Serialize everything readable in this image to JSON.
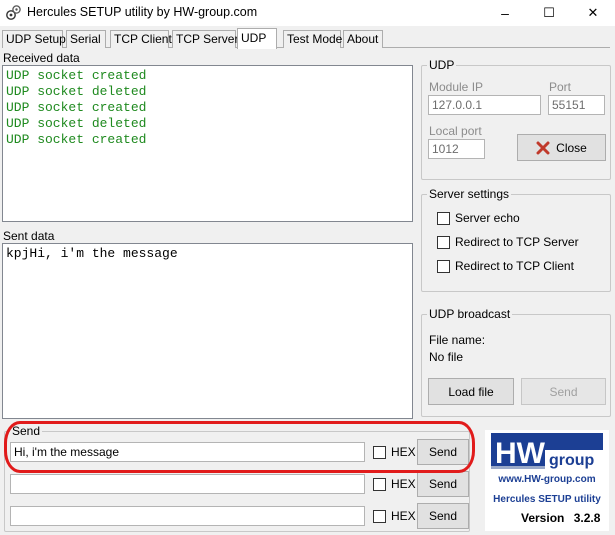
{
  "window": {
    "title": "Hercules SETUP utility by HW-group.com",
    "minimize_glyph": "–",
    "maximize_glyph": "☐",
    "close_glyph": "✕"
  },
  "tabs": [
    {
      "label": "UDP Setup",
      "active": false
    },
    {
      "label": "Serial",
      "active": false
    },
    {
      "label": "TCP Client",
      "active": false
    },
    {
      "label": "TCP Server",
      "active": false
    },
    {
      "label": "UDP",
      "active": true
    },
    {
      "label": "Test Mode",
      "active": false
    },
    {
      "label": "About",
      "active": false
    }
  ],
  "received": {
    "label": "Received data",
    "lines": [
      "UDP socket created",
      "UDP socket deleted",
      "UDP socket created",
      "UDP socket deleted",
      "UDP socket created"
    ],
    "line_color": "#1f8a1f"
  },
  "sent": {
    "label": "Sent data",
    "text": "kpjHi, i'm the message"
  },
  "udp": {
    "group_label": "UDP",
    "module_ip_label": "Module IP",
    "module_ip": "127.0.0.1",
    "port_label": "Port",
    "port": "55151",
    "local_port_label": "Local port",
    "local_port": "1012",
    "close_label": "Close",
    "close_icon_color": "#c0392b"
  },
  "server_settings": {
    "group_label": "Server settings",
    "options": [
      {
        "label": "Server echo",
        "checked": false
      },
      {
        "label": "Redirect to TCP Server",
        "checked": false
      },
      {
        "label": "Redirect to TCP Client",
        "checked": false
      }
    ]
  },
  "broadcast": {
    "group_label": "UDP broadcast",
    "file_name_label": "File name:",
    "file_name_value": "No file",
    "load_label": "Load file",
    "send_label": "Send"
  },
  "send": {
    "group_label": "Send",
    "rows": [
      {
        "value": "Hi, i'm the message",
        "hex_label": "HEX",
        "hex_checked": false,
        "send_label": "Send"
      },
      {
        "value": "",
        "hex_label": "HEX",
        "hex_checked": false,
        "send_label": "Send"
      },
      {
        "value": "",
        "hex_label": "HEX",
        "hex_checked": false,
        "send_label": "Send"
      }
    ]
  },
  "logo": {
    "hw": "HW",
    "group": "group",
    "url": "www.HW-group.com",
    "product": "Hercules SETUP utility",
    "version_label": "Version",
    "version": "3.2.8",
    "brand_color": "#1c3f94"
  },
  "annotation": {
    "color": "#e11b1b"
  }
}
